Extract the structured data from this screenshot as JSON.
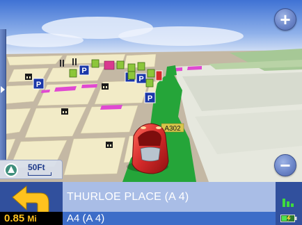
{
  "map": {
    "road_label": "A302",
    "scale_text": "50Ft"
  },
  "zoom": {
    "in_label": "+",
    "out_label": "−"
  },
  "navigation": {
    "distance_value": "0.85",
    "distance_unit": "Mi",
    "next_street": "THURLOE PLACE (A 4)",
    "current_street": "A4 (A 4)"
  },
  "icons": {
    "zoom_in": "plus-icon",
    "zoom_out": "minus-icon",
    "turn": "turn-left-arrow-icon",
    "compass": "compass-icon",
    "signal": "gps-signal-icon",
    "battery": "battery-icon",
    "vehicle": "car-icon",
    "poi_parking": "parking-icon",
    "poi_restaurant": "restaurant-icon",
    "poi_museum": "museum-icon"
  },
  "colors": {
    "sky_top": "#4a7bd8",
    "route": "#25a539",
    "building": "#f1e9c6",
    "street": "#c2b6a2",
    "ui_dark_blue": "#31509d",
    "ui_light_blue": "#a9bde6",
    "ui_mid_blue": "#3d6dc8",
    "distance_text": "#ffc21e",
    "car": "#d42a2a"
  }
}
